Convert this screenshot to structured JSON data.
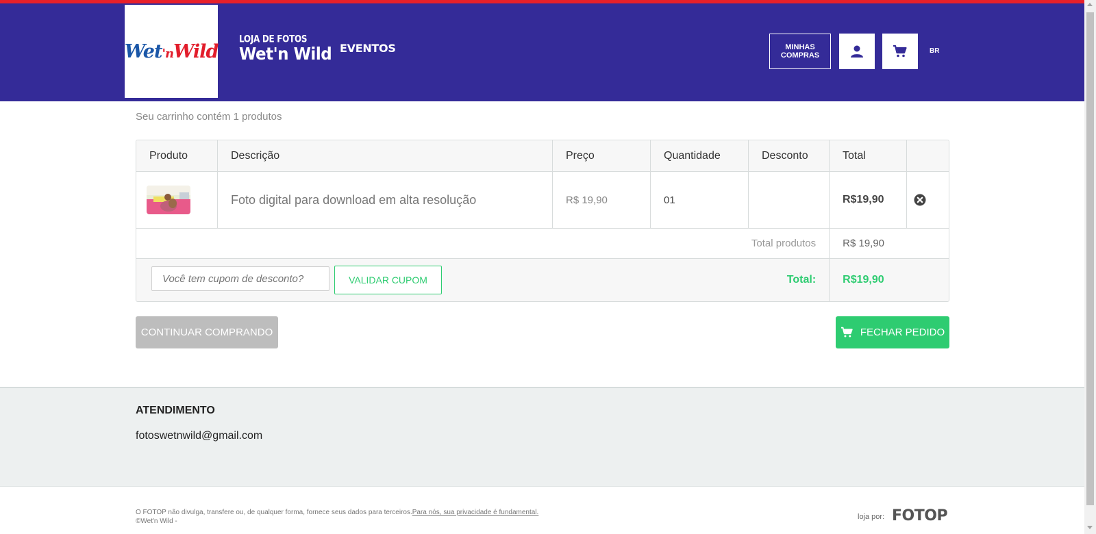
{
  "header": {
    "logo_alt": "Wet'n Wild",
    "logo_parts": [
      "Wet",
      "'n",
      "Wild"
    ],
    "store_subtitle": "LOJA DE FOTOS",
    "store_name": "Wet'n Wild",
    "nav_eventos": "EVENTOS",
    "minhas_compras": "MINHAS COMPRAS",
    "language": "BR",
    "colors": {
      "bar": "#342b98",
      "accent_line": "#e8202a"
    }
  },
  "cart": {
    "summary": "Seu carrinho contém 1 produtos",
    "columns": [
      "Produto",
      "Descrição",
      "Preço",
      "Quantidade",
      "Desconto",
      "Total",
      ""
    ],
    "items": [
      {
        "description": "Foto digital para download em alta resolução",
        "price": "R$ 19,90",
        "quantity": "01",
        "discount": "",
        "total": "R$19,90"
      }
    ],
    "subtotal_label": "Total produtos",
    "subtotal_value": "R$ 19,90",
    "coupon_placeholder": "Você tem cupom de desconto?",
    "coupon_button": "VALIDAR CUPOM",
    "total_label": "Total:",
    "total_value": "R$19,90",
    "continue_button": "CONTINUAR COMPRANDO",
    "checkout_button": "FECHAR PEDIDO",
    "colors": {
      "success": "#2ecc71",
      "disabled": "#bdbdbd"
    }
  },
  "footer": {
    "atendimento_title": "ATENDIMENTO",
    "email": "fotoswetnwild@gmail.com",
    "legal_text": "O FOTOP não divulga, transfere ou, de qualquer forma, fornece seus dados para terceiros.",
    "privacy_link": "Para nós, sua privacidade é fundamental.",
    "copyright": "©Wet'n Wild -",
    "loja_por": "loja por:",
    "brand": "FOTOP"
  }
}
